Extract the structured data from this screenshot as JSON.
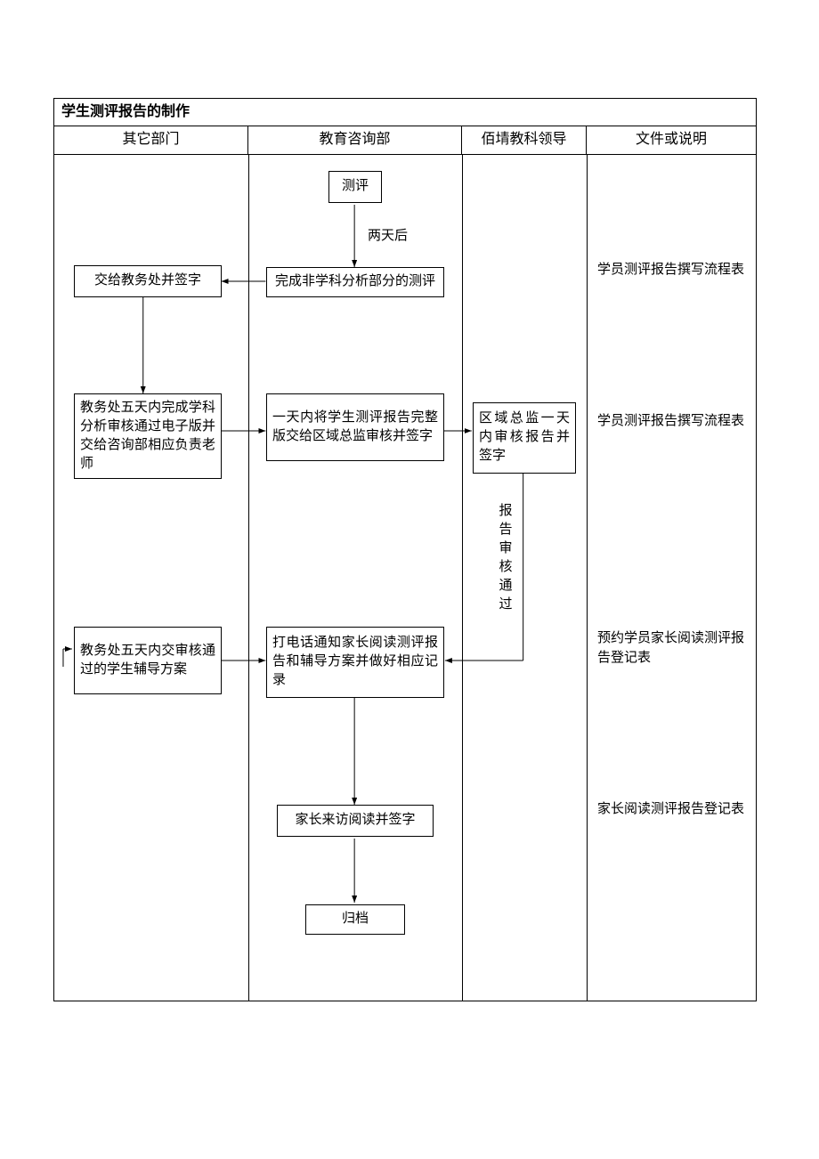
{
  "chart_data": {
    "type": "flowchart",
    "title": "学生测评报告的制作",
    "swimlanes": [
      "其它部门",
      "教育咨询部",
      "佰埥教科领导",
      "文件或说明"
    ],
    "nodes": [
      {
        "id": "start",
        "lane": "教育咨询部",
        "text": "测评"
      },
      {
        "id": "n1",
        "lane": "教育咨询部",
        "text": "完成非学科分析部分的测评"
      },
      {
        "id": "n2",
        "lane": "其它部门",
        "text": "交给教务处并签字"
      },
      {
        "id": "n3",
        "lane": "其它部门",
        "text": "教务处五天内完成学科分析审核通过电子版并交给咨询部相应负责老师"
      },
      {
        "id": "n4",
        "lane": "教育咨询部",
        "text": "一天内将学生测评报告完整版交给区域总监审核并签字"
      },
      {
        "id": "n5",
        "lane": "佰埥教科领导",
        "text": "区域总监一天内审核报告并签字"
      },
      {
        "id": "n6",
        "lane": "教育咨询部",
        "text": "打电话通知家长阅读测评报告和辅导方案并做好相应记录"
      },
      {
        "id": "n7",
        "lane": "其它部门",
        "text": "教务处五天内交审核通过的学生辅导方案"
      },
      {
        "id": "n8",
        "lane": "教育咨询部",
        "text": "家长来访阅读并签字"
      },
      {
        "id": "n9",
        "lane": "教育咨询部",
        "text": "归档"
      }
    ],
    "edges": [
      {
        "from": "start",
        "to": "n1",
        "label": "两天后"
      },
      {
        "from": "n1",
        "to": "n2"
      },
      {
        "from": "n2",
        "to": "n3"
      },
      {
        "from": "n3",
        "to": "n4"
      },
      {
        "from": "n4",
        "to": "n5"
      },
      {
        "from": "n5",
        "to": "n6",
        "label": "报告审核通过"
      },
      {
        "from": "n7",
        "to": "n6"
      },
      {
        "from": "n6",
        "to": "n8"
      },
      {
        "from": "n8",
        "to": "n9"
      }
    ],
    "annotations": [
      {
        "lane": "文件或说明",
        "row": 1,
        "text": "学员测评报告撰写流程表"
      },
      {
        "lane": "文件或说明",
        "row": 2,
        "text": "学员测评报告撰写流程表"
      },
      {
        "lane": "文件或说明",
        "row": 3,
        "text": "预约学员家长阅读测评报告登记表"
      },
      {
        "lane": "文件或说明",
        "row": 4,
        "text": "家长阅读测评报告登记表"
      }
    ]
  },
  "diagram": {
    "title": "学生测评报告的制作",
    "lanes": {
      "c1": "其它部门",
      "c2": "教育咨询部",
      "c3": "佰埥教科领导",
      "c4": "文件或说明"
    },
    "nodes": {
      "start": "测评",
      "n1": "完成非学科分析部分的测评",
      "n2": "交给教务处并签字",
      "n3": "教务处五天内完成学科分析审核通过电子版并交给咨询部相应负责老师",
      "n4": "一天内将学生测评报告完整版交给区域总监审核并签字",
      "n5": "区域总监一天内审核报告并签字",
      "n6": "打电话通知家长阅读测评报告和辅导方案并做好相应记录",
      "n7": "教务处五天内交审核通过的学生辅导方案",
      "n8": "家长来访阅读并签字",
      "n9": "归档"
    },
    "edgeLabels": {
      "e_start_n1": "两天后",
      "e_n5_n6": "报告审核通过"
    },
    "notes": {
      "note1": "学员测评报告撰写流程表",
      "note2": "学员测评报告撰写流程表",
      "note3": "预约学员家长阅读测评报告登记表",
      "note4": "家长阅读测评报告登记表"
    }
  }
}
